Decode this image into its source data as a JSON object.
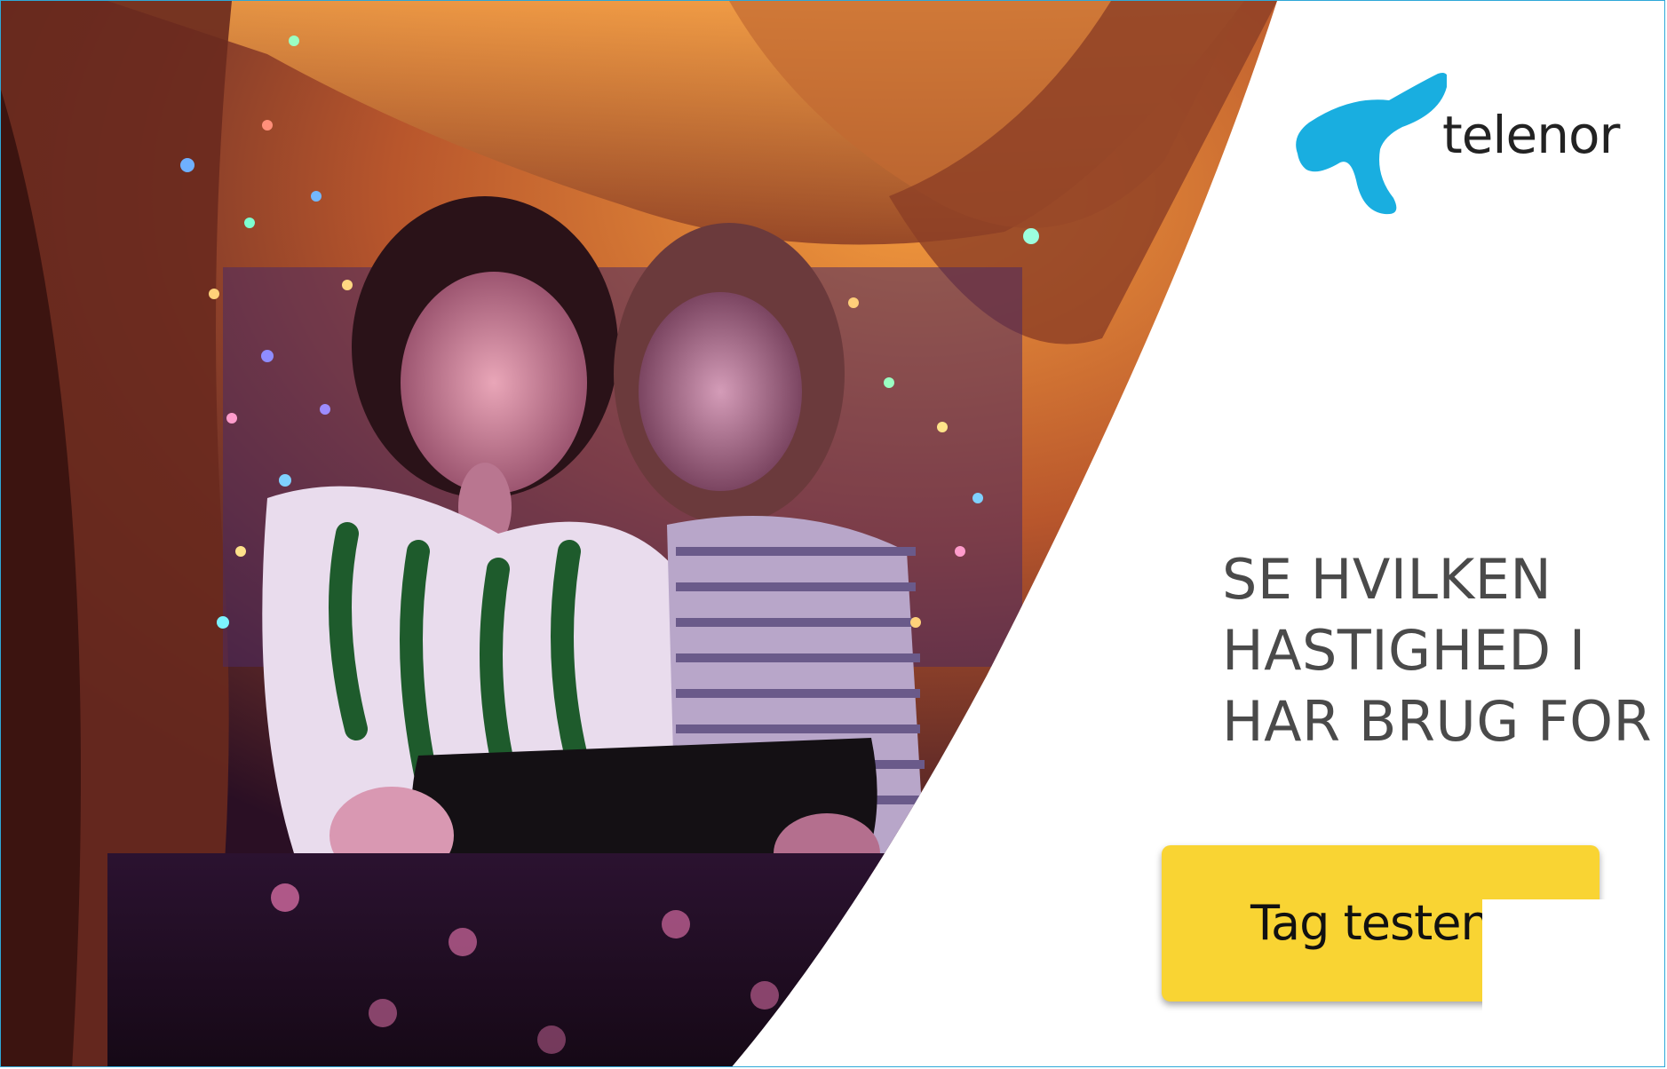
{
  "ad": {
    "brand_name": "telenor",
    "headline_lines": [
      "SE HVILKEN",
      "HASTIGHED I",
      "HAR BRUG FOR"
    ],
    "cta_label": "Tag testen",
    "photo_alt": "Two children reading a tablet inside a blanket fort lit by string lights"
  },
  "colors": {
    "brand_blue": "#19aee0",
    "cta_yellow": "#f9d433",
    "headline_gray": "#4a4a4a",
    "frame_border": "#2ea8d8"
  },
  "icons": {
    "logo": "telenor-propeller-icon"
  }
}
